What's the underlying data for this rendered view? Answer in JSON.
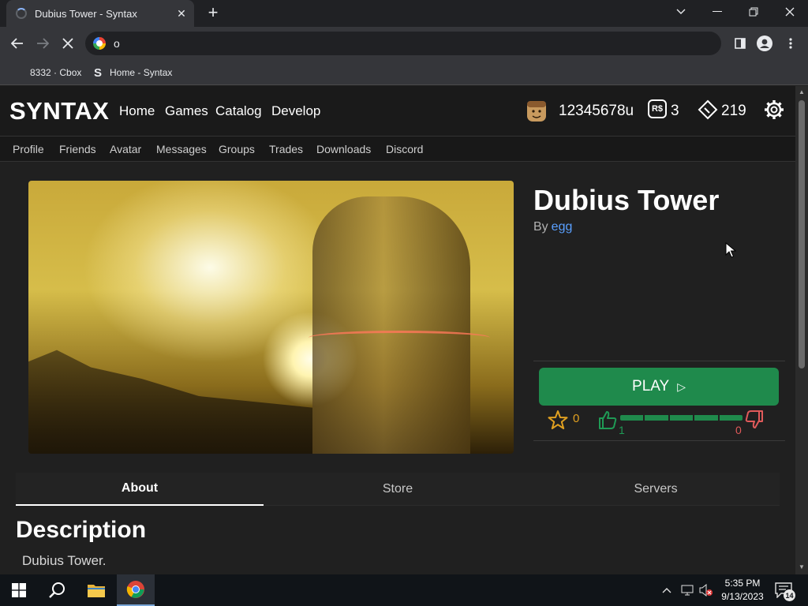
{
  "browser": {
    "tab_title": "Dubius Tower - Syntax",
    "new_tab_label": "+",
    "address_text": "o",
    "bookmarks": [
      {
        "label": "8332 · Cbox",
        "icon": ""
      },
      {
        "label": "Home - Syntax",
        "icon": "S"
      }
    ]
  },
  "site": {
    "logo": "SYNTAX",
    "nav": [
      "Home",
      "Games",
      "Catalog",
      "Develop"
    ],
    "username": "12345678u",
    "robux_icon": "R$",
    "robux": "3",
    "tickets": "219",
    "subnav": [
      "Profile",
      "Friends",
      "Avatar",
      "Messages",
      "Groups",
      "Trades",
      "Downloads",
      "Discord"
    ]
  },
  "game": {
    "title": "Dubius Tower",
    "by_label": "By",
    "creator": "egg",
    "play_label": "PLAY",
    "favorites": "0",
    "upvotes": "1",
    "downvotes": "0",
    "upvote_ratio": 1.0
  },
  "tabs": [
    "About",
    "Store",
    "Servers"
  ],
  "description": {
    "heading": "Description",
    "text": "Dubius Tower."
  },
  "taskbar": {
    "time": "5:35 PM",
    "date": "9/13/2023",
    "notification_count": "14"
  },
  "colors": {
    "play_button": "#1f8a4c",
    "link": "#5aa0ff",
    "favorite": "#e0a020",
    "downvote": "#e05a5a"
  }
}
